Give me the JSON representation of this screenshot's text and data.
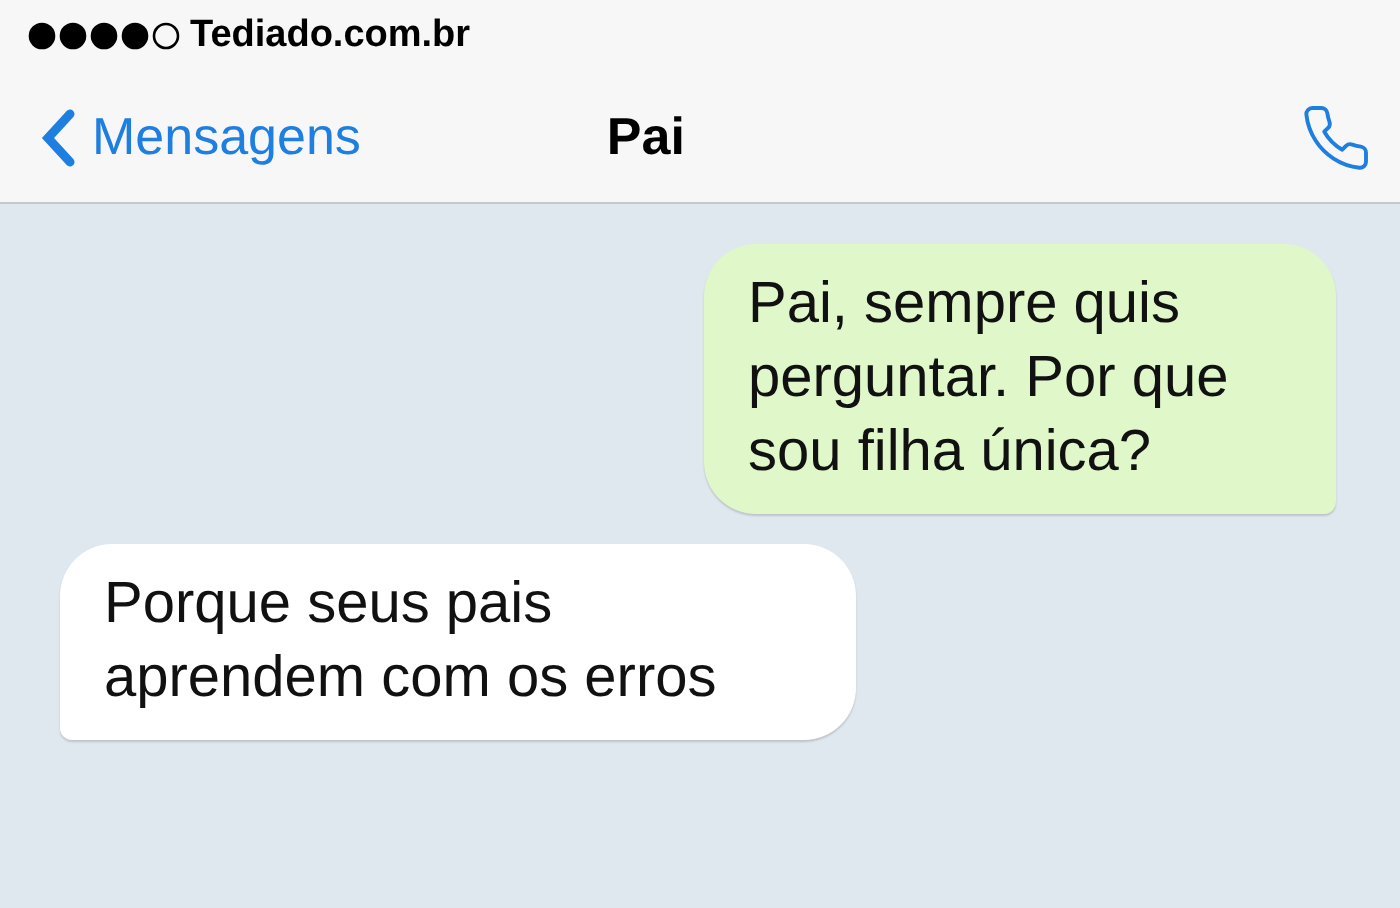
{
  "status_bar": {
    "carrier": "Tediado.com.br"
  },
  "header": {
    "back_label": "Mensagens",
    "title": "Pai"
  },
  "messages": [
    {
      "kind": "sent",
      "text": "Pai, sempre quis perguntar. Por que sou filha única?"
    },
    {
      "kind": "received",
      "text": "Porque seus pais aprendem com os erros"
    }
  ]
}
